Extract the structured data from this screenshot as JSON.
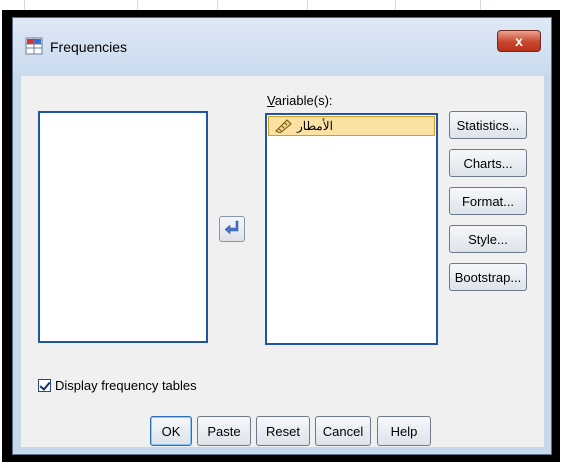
{
  "window": {
    "title": "Frequencies",
    "close_label": "x"
  },
  "target": {
    "label": "Variable(s):",
    "items": [
      {
        "name": "الأمطار",
        "icon": "ruler-scale-icon"
      }
    ]
  },
  "side_buttons": {
    "statistics": "Statistics...",
    "charts": "Charts...",
    "format": "Format...",
    "style": "Style...",
    "bootstrap": "Bootstrap..."
  },
  "options": {
    "display_frequency_tables": "Display frequency tables",
    "display_frequency_tables_checked": true
  },
  "buttons": {
    "ok": "OK",
    "paste": "Paste",
    "reset": "Reset",
    "cancel": "Cancel",
    "help": "Help"
  },
  "colors": {
    "accent": "#1f55a6",
    "selected_item_bg": "#fbe2a3",
    "close_button": "#c9452c"
  }
}
